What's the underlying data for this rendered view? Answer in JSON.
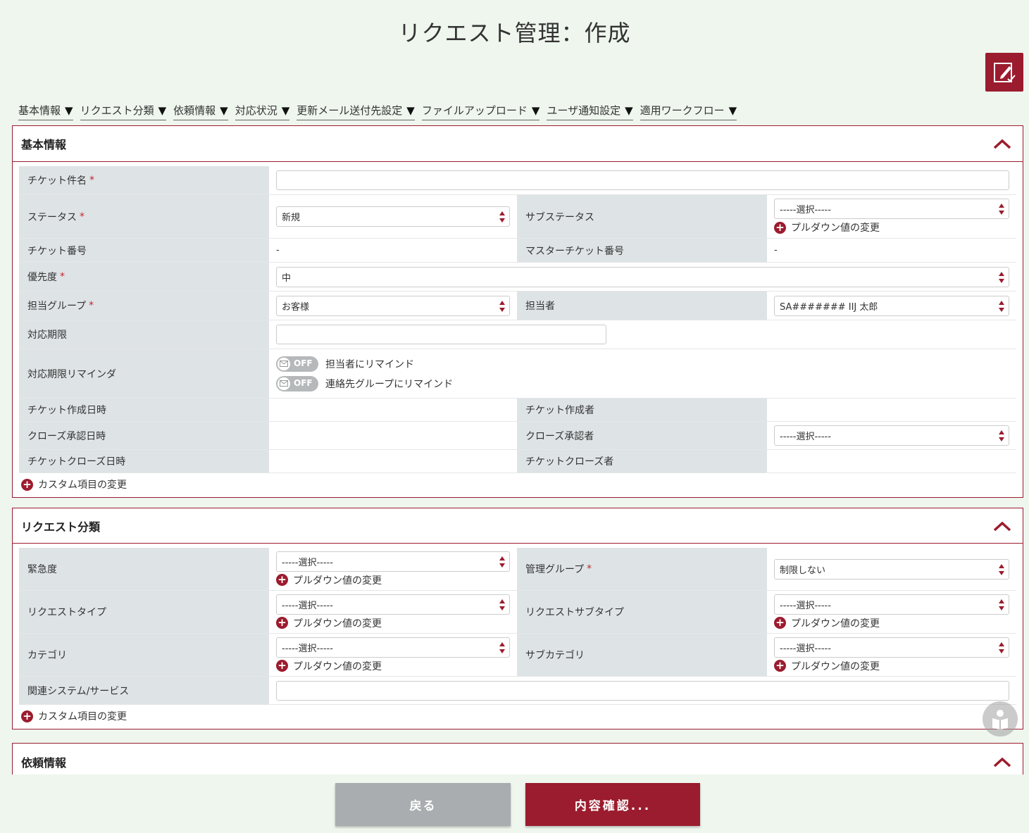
{
  "page": {
    "title": "リクエスト管理：作成",
    "edit_icon": "edit-icon"
  },
  "anchor_nav": [
    {
      "label": "基本情報"
    },
    {
      "label": "リクエスト分類"
    },
    {
      "label": "依頼情報"
    },
    {
      "label": "対応状況"
    },
    {
      "label": "更新メール送付先設定"
    },
    {
      "label": "ファイルアップロード"
    },
    {
      "label": "ユーザ通知設定"
    },
    {
      "label": "適用ワークフロー"
    }
  ],
  "basic": {
    "title": "基本情報",
    "ticket_subject_label": "チケット件名",
    "status_label": "ステータス",
    "status_value": "新規",
    "substatus_label": "サブステータス",
    "substatus_value": "-----選択-----",
    "pulldown_change": "プルダウン値の変更",
    "ticket_no_label": "チケット番号",
    "ticket_no_value": "-",
    "master_ticket_label": "マスターチケット番号",
    "master_ticket_value": "-",
    "priority_label": "優先度",
    "priority_value": "中",
    "group_label": "担当グループ",
    "group_value": "お客様",
    "assignee_label": "担当者",
    "assignee_value": "SA####### IIJ 太郎",
    "deadline_label": "対応期限",
    "reminder_label": "対応期限リマインダ",
    "toggle_off": "OFF",
    "remind_assignee": "担当者にリマインド",
    "remind_group": "連絡先グループにリマインド",
    "created_at_label": "チケット作成日時",
    "creator_label": "チケット作成者",
    "close_approved_at_label": "クローズ承認日時",
    "close_approver_label": "クローズ承認者",
    "close_approver_value": "-----選択-----",
    "closed_at_label": "チケットクローズ日時",
    "closer_label": "チケットクローズ者",
    "custom_change": "カスタム項目の変更",
    "required_mark": "*"
  },
  "category": {
    "title": "リクエスト分類",
    "urgency_label": "緊急度",
    "urgency_value": "-----選択-----",
    "mgmt_group_label": "管理グループ",
    "mgmt_group_value": "制限しない",
    "req_type_label": "リクエストタイプ",
    "req_type_value": "-----選択-----",
    "req_subtype_label": "リクエストサブタイプ",
    "req_subtype_value": "-----選択-----",
    "cat_label": "カテゴリ",
    "cat_value": "-----選択-----",
    "subcat_label": "サブカテゴリ",
    "subcat_value": "-----選択-----",
    "related_label": "関連システム/サービス",
    "pulldown_change": "プルダウン値の変更",
    "custom_change": "カスタム項目の変更",
    "required_mark": "*"
  },
  "request_info": {
    "title": "依頼情報"
  },
  "footer": {
    "back_label": "戻る",
    "confirm_label": "内容確認..."
  },
  "colors": {
    "brand": "#9b1c2e",
    "background": "#eef6ee",
    "label_bg": "#dee3e6",
    "back_button": "#a9adaf"
  }
}
